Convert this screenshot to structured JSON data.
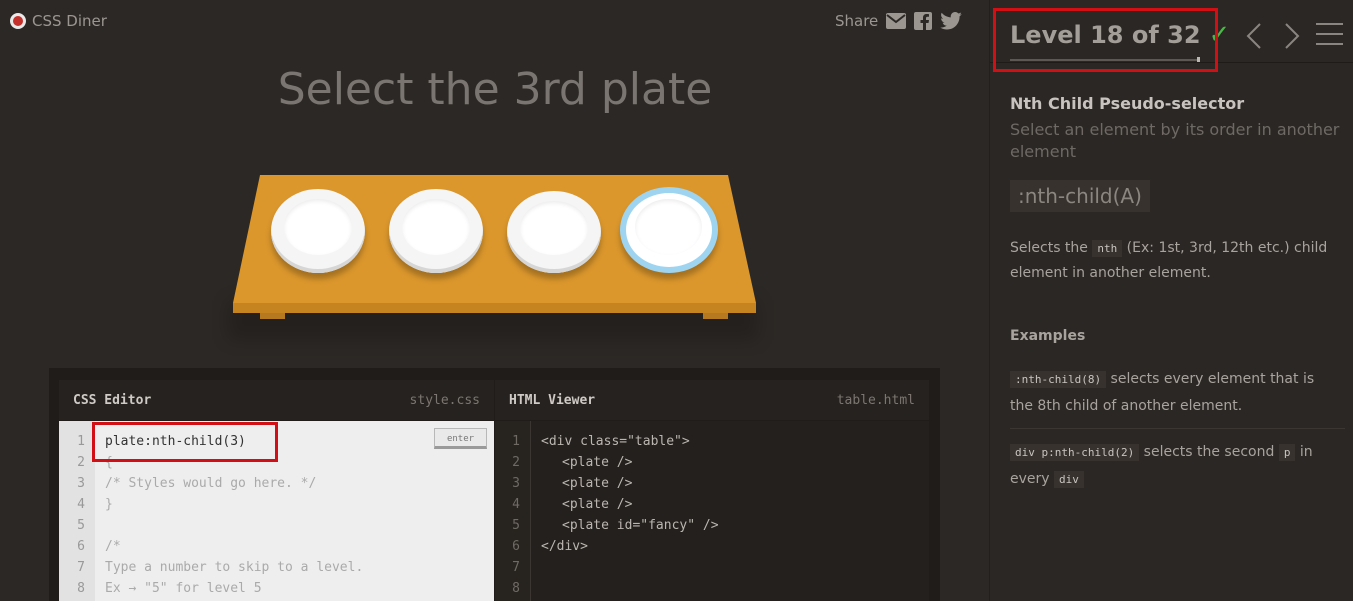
{
  "header": {
    "logo_text": "CSS Diner",
    "share_label": "Share",
    "share_icons": [
      "mail-icon",
      "facebook-icon",
      "twitter-icon"
    ]
  },
  "task": {
    "title": "Select the 3rd plate"
  },
  "table": {
    "plates": [
      {
        "kind": "plate"
      },
      {
        "kind": "plate"
      },
      {
        "kind": "plate"
      },
      {
        "kind": "plate",
        "id": "fancy"
      }
    ]
  },
  "css_editor": {
    "title": "CSS Editor",
    "filename": "style.css",
    "enter_label": "enter",
    "line_numbers": [
      "1",
      "2",
      "3",
      "4",
      "5",
      "6",
      "7",
      "8"
    ],
    "input_value": "plate:nth-child(3)",
    "lines": [
      "{",
      "/* Styles would go here. */",
      "}",
      "",
      "/*",
      "Type a number to skip to a level.",
      "Ex → \"5\" for level 5"
    ]
  },
  "html_viewer": {
    "title": "HTML Viewer",
    "filename": "table.html",
    "line_numbers": [
      "1",
      "2",
      "3",
      "4",
      "5",
      "6",
      "7",
      "8"
    ],
    "lines": [
      "<div class=\"table\">",
      "<plate />",
      "<plate />",
      "<plate />",
      "<plate id=\"fancy\" />",
      "</div>",
      "",
      ""
    ]
  },
  "sidebar": {
    "level_text": "Level 18 of 32",
    "check": "✓",
    "selector_name": "Nth Child Pseudo-selector",
    "selector_title": "Select an element by its order in another element",
    "syntax": ":nth-child(A)",
    "desc_pre": "Selects the ",
    "desc_tok": "nth",
    "desc_post": " (Ex: 1st, 3rd, 12th etc.) child element in another element.",
    "examples_heading": "Examples",
    "example1_code": ":nth-child(8)",
    "example1_text": " selects every element that is the 8th child of another element.",
    "example2_code": "div p:nth-child(2)",
    "example2_mid": " selects the second ",
    "example2_tok": "p",
    "example2_post": " in every ",
    "example2_tok2": "div"
  },
  "colors": {
    "background": "#2c2825",
    "table_wood": "#d8952c",
    "fancy_plate_ring": "#9fd4f1",
    "highlight": "#d10f14",
    "check": "#4cb648"
  }
}
